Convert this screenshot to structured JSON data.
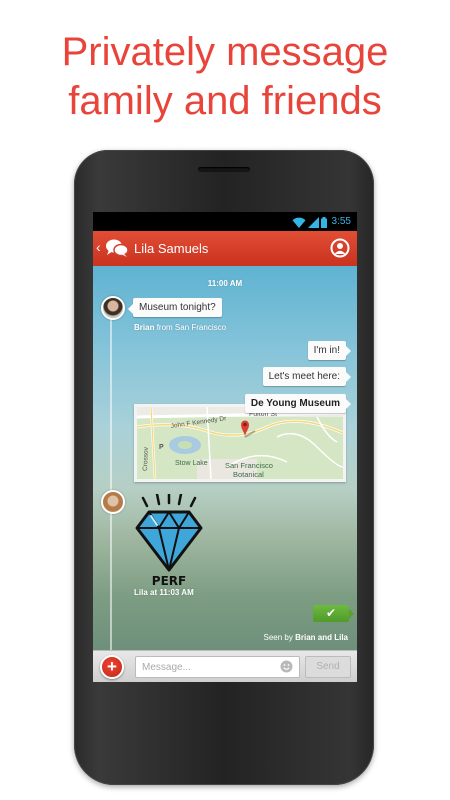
{
  "promo": {
    "headline_line1": "Privately message",
    "headline_line2": "family and friends"
  },
  "status_bar": {
    "time": "3:55",
    "icons": [
      "wifi-icon",
      "signal-icon",
      "battery-icon"
    ]
  },
  "app_bar": {
    "back_icon": "chevron-left-icon",
    "logo_icon": "chat-bubbles-icon",
    "contact_name": "Lila Samuels",
    "profile_icon": "person-circle-icon",
    "color": "#d83f28"
  },
  "conversation": {
    "timestamp": "11:00 AM",
    "messages": [
      {
        "text": "Museum tonight?"
      },
      {
        "text": "I'm in!"
      },
      {
        "text": "Let's meet here:"
      },
      {
        "text": "De Young Museum"
      }
    ],
    "brian_meta": {
      "name": "Brian",
      "from_text": "from San Francisco"
    },
    "map_labels": {
      "street_fulton": "Fulton St",
      "street_kennedy": "John F Kennedy Dr",
      "lake": "Stow Lake",
      "garden_line1": "San Francisco",
      "garden_line2": "Botanical",
      "crossover": "Crossov",
      "parking": "P"
    },
    "sticker_text": "PERF",
    "lila_meta": "Lila at 11:03 AM",
    "seen": {
      "prefix": "Seen by",
      "names": "Brian and Lila"
    }
  },
  "composer": {
    "add_icon": "plus-icon",
    "placeholder": "Message...",
    "emoji_icon": "smiley-icon",
    "send_label": "Send"
  },
  "colors": {
    "headline": "#e8443a",
    "accent_red": "#d83f28",
    "sent_green": "#5aa92f",
    "status_blue": "#33b5e5"
  }
}
